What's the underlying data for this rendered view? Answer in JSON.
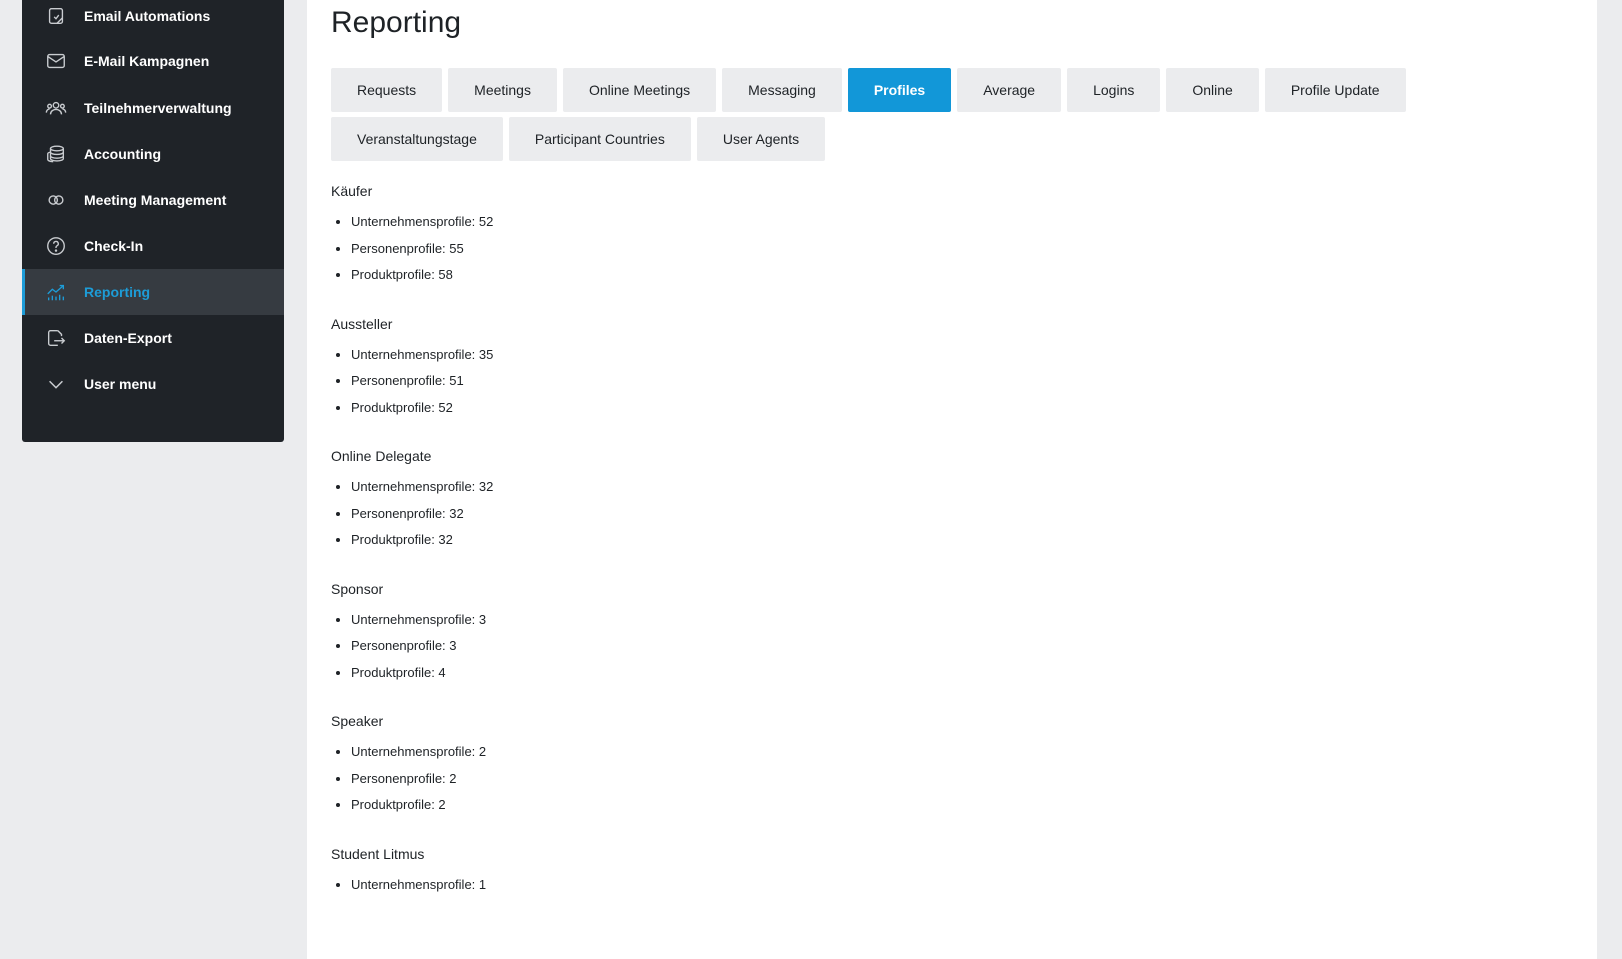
{
  "sidebar": {
    "items": [
      {
        "label": "Email Automations",
        "icon": "email-automation-icon"
      },
      {
        "label": "E-Mail Kampagnen",
        "icon": "envelope-icon"
      },
      {
        "label": "Teilnehmerverwaltung",
        "icon": "users-icon"
      },
      {
        "label": "Accounting",
        "icon": "coins-icon"
      },
      {
        "label": "Meeting Management",
        "icon": "rings-icon"
      },
      {
        "label": "Check-In",
        "icon": "question-circle-icon"
      },
      {
        "label": "Reporting",
        "icon": "chart-icon",
        "active": true
      },
      {
        "label": "Daten-Export",
        "icon": "export-icon"
      },
      {
        "label": "User menu",
        "icon": "chevron-down-icon"
      }
    ]
  },
  "main": {
    "title": "Reporting",
    "tabs": [
      {
        "label": "Requests"
      },
      {
        "label": "Meetings"
      },
      {
        "label": "Online Meetings"
      },
      {
        "label": "Messaging"
      },
      {
        "label": "Profiles",
        "active": true
      },
      {
        "label": "Average"
      },
      {
        "label": "Logins"
      },
      {
        "label": "Online"
      },
      {
        "label": "Profile Update"
      },
      {
        "label": "Veranstaltungstage"
      },
      {
        "label": "Participant Countries"
      },
      {
        "label": "User Agents"
      }
    ],
    "groups": [
      {
        "title": "Käufer",
        "items": [
          "Unternehmensprofile: 52",
          "Personenprofile: 55",
          "Produktprofile: 58"
        ]
      },
      {
        "title": "Aussteller",
        "items": [
          "Unternehmensprofile: 35",
          "Personenprofile: 51",
          "Produktprofile: 52"
        ]
      },
      {
        "title": "Online Delegate",
        "items": [
          "Unternehmensprofile: 32",
          "Personenprofile: 32",
          "Produktprofile: 32"
        ]
      },
      {
        "title": "Sponsor",
        "items": [
          "Unternehmensprofile: 3",
          "Personenprofile: 3",
          "Produktprofile: 4"
        ]
      },
      {
        "title": "Speaker",
        "items": [
          "Unternehmensprofile: 2",
          "Personenprofile: 2",
          "Produktprofile: 2"
        ]
      },
      {
        "title": "Student Litmus",
        "items": [
          "Unternehmensprofile: 1"
        ]
      }
    ]
  },
  "colors": {
    "accent": "#1297d8",
    "sidebar_bg": "#1f2328",
    "sidebar_active_bg": "#363b41"
  }
}
